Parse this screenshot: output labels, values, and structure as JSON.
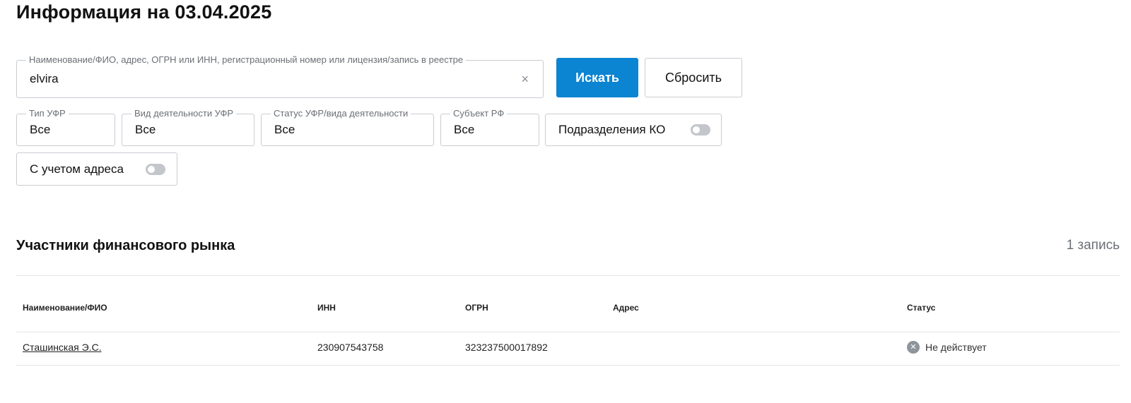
{
  "page": {
    "title": "Информация на 03.04.2025"
  },
  "search": {
    "legend": "Наименование/ФИО, адрес, ОГРН или ИНН, регистрационный номер или лицензия/запись в реестре",
    "value": "elvira",
    "clear_symbol": "×",
    "search_label": "Искать",
    "reset_label": "Сбросить"
  },
  "filters": {
    "type": {
      "legend": "Тип УФР",
      "value": "Все"
    },
    "activity": {
      "legend": "Вид деятельности УФР",
      "value": "Все"
    },
    "status": {
      "legend": "Статус УФР/вида деятельности",
      "value": "Все"
    },
    "region": {
      "legend": "Субъект РФ",
      "value": "Все"
    },
    "ko_divisions": {
      "label": "Подразделения КО",
      "enabled": false
    },
    "with_address": {
      "label": "С учетом адреса",
      "enabled": false
    }
  },
  "results": {
    "title": "Участники финансового рынка",
    "count_label": "1 запись",
    "columns": [
      "Наименование/ФИО",
      "ИНН",
      "ОГРН",
      "Адрес",
      "Статус"
    ],
    "rows": [
      {
        "name": "Сташинская Э.С.",
        "inn": "230907543758",
        "ogrn": "323237500017892",
        "address": "",
        "status": "Не действует",
        "status_symbol": "✕",
        "status_color": "#8e949b"
      }
    ]
  },
  "colors": {
    "accent": "#0b84d2",
    "border": "#c9ccd1",
    "muted_text": "#6b6f75"
  }
}
